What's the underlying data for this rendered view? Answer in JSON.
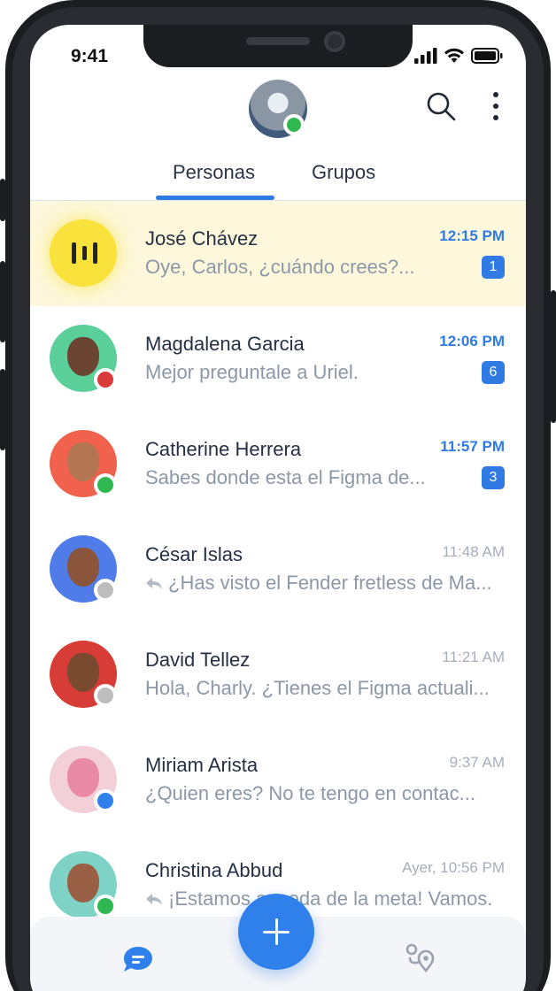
{
  "status_bar": {
    "time": "9:41"
  },
  "tabs": [
    {
      "label": "Personas",
      "active": true
    },
    {
      "label": "Grupos",
      "active": false
    }
  ],
  "colors": {
    "accent": "#2f7be3",
    "online": "#2fb84f",
    "busy": "#d93a3a",
    "offline": "#bdbdbd",
    "away": "#2f80ea",
    "highlight_row": "#fdf8dc"
  },
  "conversations": [
    {
      "name": "José Chávez",
      "message": "Oye, Carlos, ¿cuándo crees?...",
      "time": "12:15 PM",
      "unread": "1",
      "avatar": "audio-icon",
      "status": "",
      "replied": false
    },
    {
      "name": "Magdalena Garcia",
      "message": "Mejor preguntale a Uriel.",
      "time": "12:06 PM",
      "unread": "6",
      "avatar": "person",
      "status": "busy",
      "replied": false
    },
    {
      "name": "Catherine Herrera",
      "message": "Sabes donde esta el Figma de...",
      "time": "11:57 PM",
      "unread": "3",
      "avatar": "person",
      "status": "online",
      "replied": false
    },
    {
      "name": "César Islas",
      "message": "¿Has visto el Fender fretless de Ma...",
      "time": "11:48 AM",
      "unread": "",
      "avatar": "person",
      "status": "offline",
      "replied": true
    },
    {
      "name": "David Tellez",
      "message": "Hola, Charly. ¿Tienes el Figma actuali...",
      "time": "11:21 AM",
      "unread": "",
      "avatar": "person",
      "status": "offline",
      "replied": false
    },
    {
      "name": "Miriam Arista",
      "message": "¿Quien eres? No te tengo en contac...",
      "time": "9:37 AM",
      "unread": "",
      "avatar": "person",
      "status": "away",
      "replied": false
    },
    {
      "name": "Christina Abbud",
      "message": "¡Estamos a meda de la meta! Vamos.",
      "time": "Ayer, 10:56 PM",
      "unread": "",
      "avatar": "person",
      "status": "online",
      "replied": true
    }
  ],
  "bottom_nav": [
    {
      "icon": "chat-icon",
      "active": true
    },
    {
      "icon": "plus-icon",
      "active": false
    },
    {
      "icon": "map-pin-icon",
      "active": false
    }
  ]
}
